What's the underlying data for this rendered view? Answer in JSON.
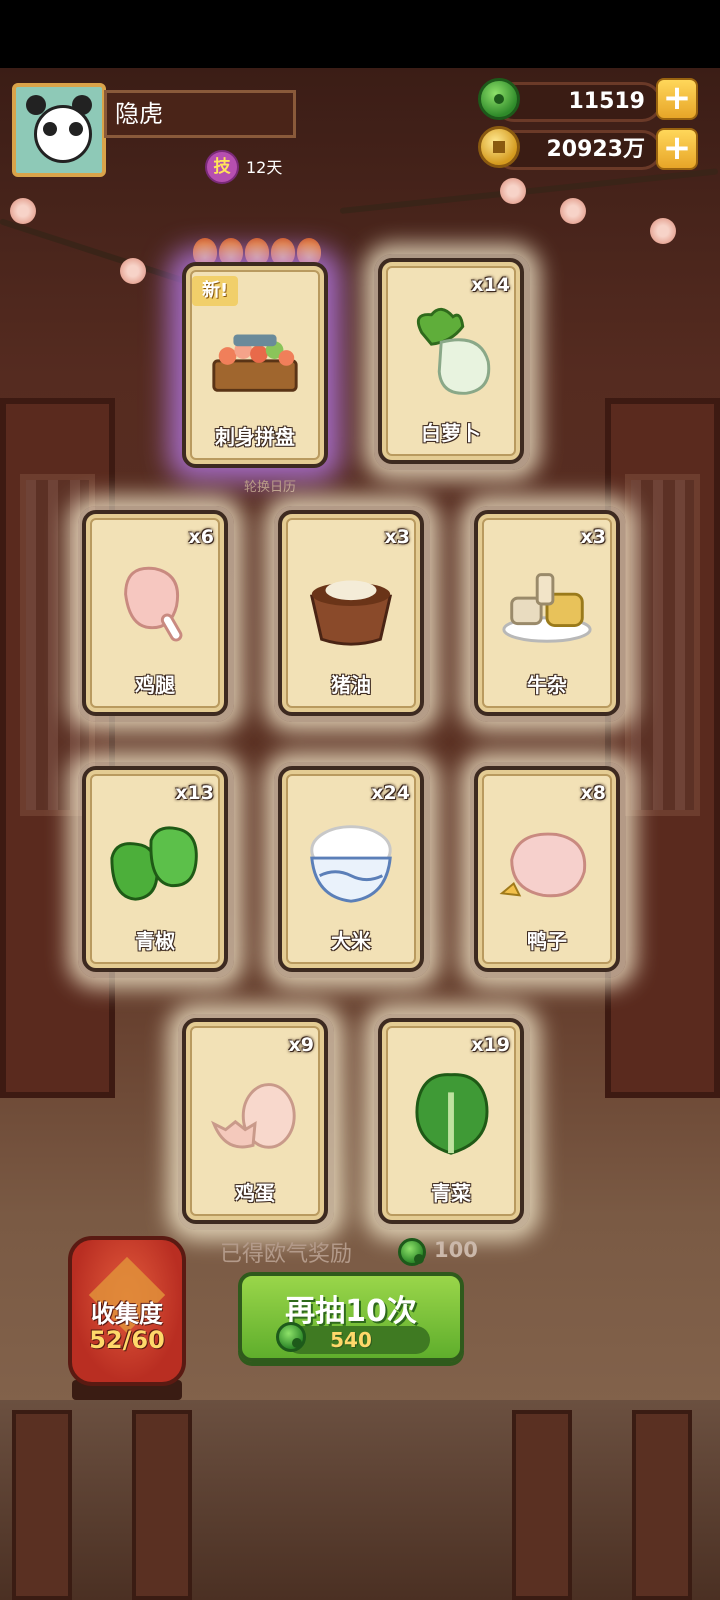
{
  "player": {
    "name": "隐虎",
    "skill_badge": "技",
    "days": "12天"
  },
  "currency": {
    "jade": {
      "icon": "jade-coin-icon",
      "value": "11519"
    },
    "gold": {
      "icon": "gold-coin-icon",
      "value": "20923万"
    }
  },
  "cards": [
    {
      "name": "刺身拼盘",
      "count": "",
      "is_new": true,
      "new_tag": "新!",
      "icon": "sashimi-platter-icon"
    },
    {
      "name": "白萝卜",
      "count": "x14",
      "icon": "white-radish-icon"
    },
    {
      "name": "鸡腿",
      "count": "x6",
      "icon": "chicken-leg-icon"
    },
    {
      "name": "猪油",
      "count": "x3",
      "icon": "lard-icon"
    },
    {
      "name": "牛杂",
      "count": "x3",
      "icon": "beef-offal-icon"
    },
    {
      "name": "青椒",
      "count": "x13",
      "icon": "green-pepper-icon"
    },
    {
      "name": "大米",
      "count": "x24",
      "icon": "rice-bowl-icon"
    },
    {
      "name": "鸭子",
      "count": "x8",
      "icon": "duck-icon"
    },
    {
      "name": "鸡蛋",
      "count": "x9",
      "icon": "egg-icon"
    },
    {
      "name": "青菜",
      "count": "x19",
      "icon": "greens-icon"
    }
  ],
  "calendar_label": "轮换日历",
  "reward": {
    "label": "已得欧气奖励",
    "value": "100"
  },
  "collection": {
    "title": "收集度",
    "progress": "52/60"
  },
  "draw_button": {
    "label": "再抽10次",
    "cost": "540"
  },
  "colors": {
    "accent_green": "#5fae2c",
    "gold": "#e7a528",
    "card_bg": "#f2e1b6"
  }
}
